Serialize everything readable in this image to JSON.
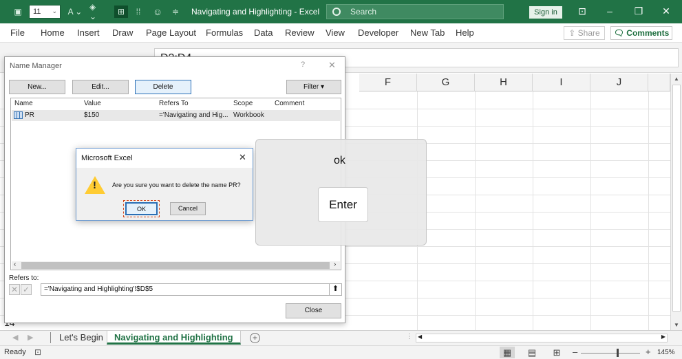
{
  "titlebar": {
    "font_size": "11",
    "title": "Navigating and Highlighting  -  Excel",
    "search_placeholder": "Search",
    "sign_in": "Sign in"
  },
  "menu": [
    "File",
    "Home",
    "Insert",
    "Draw",
    "Page Layout",
    "Formulas",
    "Data",
    "Review",
    "View",
    "Developer",
    "New Tab",
    "Help"
  ],
  "share_label": "Share",
  "comments_label": "Comments",
  "formula_bar": {
    "content": "D2:D4"
  },
  "columns": [
    "F",
    "G",
    "H",
    "I",
    "J"
  ],
  "visible_row_number": "14",
  "sheets": {
    "tabs": [
      "Let's Begin",
      "Navigating and Highlighting"
    ],
    "active": "Navigating and Highlighting"
  },
  "status": {
    "ready": "Ready",
    "zoom": "145%"
  },
  "name_manager": {
    "title": "Name Manager",
    "help": "?",
    "buttons": {
      "new": "New...",
      "edit": "Edit...",
      "delete": "Delete",
      "filter": "Filter"
    },
    "headers": [
      "Name",
      "Value",
      "Refers To",
      "Scope",
      "Comment"
    ],
    "rows": [
      {
        "name": "PR",
        "value": "$150",
        "refers_to": "='Navigating and Hig...",
        "scope": "Workbook",
        "comment": ""
      }
    ],
    "refers_label": "Refers to:",
    "refers_value": "='Navigating and Highlighting'!$D$5",
    "close": "Close"
  },
  "confirm_dialog": {
    "title": "Microsoft Excel",
    "message": "Are you sure you want to delete the name PR?",
    "ok": "OK",
    "cancel": "Cancel"
  },
  "key_overlay": {
    "typed": "ok",
    "key": "Enter"
  },
  "colors": {
    "excel_green": "#217346",
    "focus_blue": "#2a6fb6"
  }
}
